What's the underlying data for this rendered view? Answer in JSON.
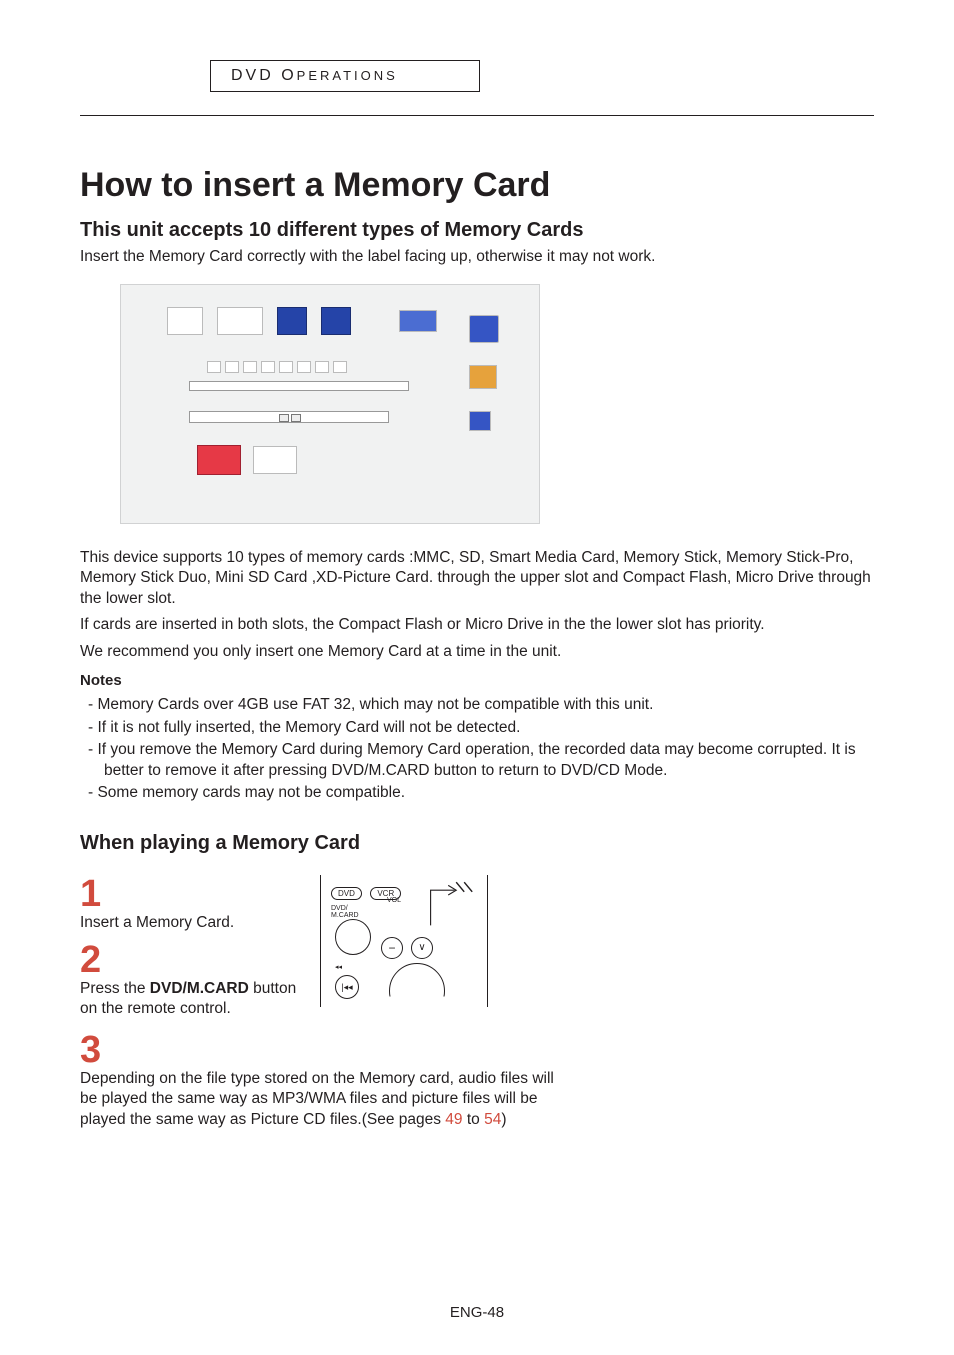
{
  "section_header": {
    "big": "DVD O",
    "small": "PERATIONS"
  },
  "title": "How to insert a Memory Card",
  "subtitle": "This unit accepts 10 different types of Memory Cards",
  "lead": "Insert the Memory Card correctly with the label facing up, otherwise it may not work.",
  "body1": "This device supports 10 types of memory cards :MMC, SD, Smart Media Card, Memory Stick, Memory Stick-Pro, Memory Stick Duo, Mini SD Card ,XD-Picture Card. through the upper slot and Compact Flash, Micro Drive through the lower slot.",
  "body2": "If cards are inserted in both slots, the Compact Flash or Micro Drive in the the lower slot has priority.",
  "body3": "We recommend you only insert one Memory Card at a time in the unit.",
  "notes_label": "Notes",
  "notes": [
    "Memory Cards over 4GB use FAT 32, which may not be compatible with this unit.",
    "If it is not fully inserted, the Memory Card will not be detected.",
    "If you remove the Memory Card during Memory Card operation, the recorded data may become corrupted. It is better to remove it after pressing DVD/M.CARD button to return to DVD/CD Mode.",
    "Some memory cards may not be compatible."
  ],
  "play_heading": "When playing a Memory Card",
  "steps": {
    "s1_num": "1",
    "s1_text": "Insert a Memory Card.",
    "s2_num": "2",
    "s2_text_a": "Press the ",
    "s2_bold": "DVD/M.CARD",
    "s2_text_b": " button on the remote control.",
    "s3_num": "3",
    "s3_text": "Depending on the file type stored on the Memory card, audio files will be played the same way as MP3/WMA files and picture files will be played the same way as Picture CD files.(See pages ",
    "s3_pg1": "49",
    "s3_to": " to ",
    "s3_pg2": "54",
    "s3_close": ")"
  },
  "remote": {
    "dvd": "DVD",
    "vcr": "VCR",
    "vol": "VOL",
    "mcard": "DVD/\nM.CARD",
    "minus": "−",
    "down": "∨",
    "rw_glyph": "◂◂",
    "prev_glyph": "|◂◂"
  },
  "footer": "ENG-48"
}
